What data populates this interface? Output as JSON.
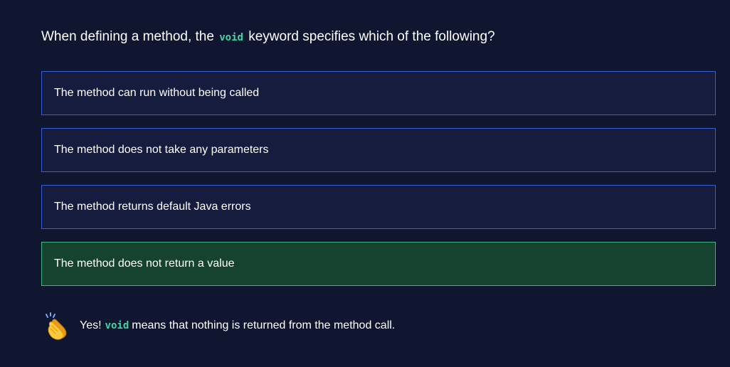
{
  "question": {
    "prefix": "When defining a method, the",
    "code": "void",
    "suffix": "keyword specifies which of the following?"
  },
  "options": [
    {
      "label": "The method can run without being called",
      "state": "default"
    },
    {
      "label": "The method does not take any parameters",
      "state": "default"
    },
    {
      "label": "The method returns default Java errors",
      "state": "default"
    },
    {
      "label": "The method does not return a value",
      "state": "correct"
    }
  ],
  "feedback": {
    "icon": "clapping-hands-icon",
    "prefix": "Yes!",
    "code": "void",
    "suffix": "means that nothing is returned from the method call."
  },
  "colors": {
    "background": "#10162f",
    "option_bg": "#151c3e",
    "option_border": "#3a5cd8",
    "correct_bg": "#16432f",
    "correct_border": "#3bb580",
    "code": "#3fd6a6"
  }
}
